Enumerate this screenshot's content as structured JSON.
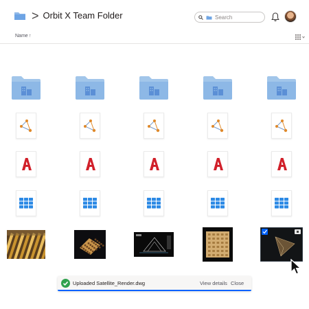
{
  "header": {
    "chevron": ">",
    "title": "Orbit X Team Folder",
    "search_placeholder": "Search",
    "folder_icon": "folder-icon",
    "search_icon": "search-icon",
    "bell_icon": "bell-icon"
  },
  "list": {
    "name_column": "Name",
    "sort_indicator": "↑"
  },
  "rows": [
    {
      "type": "folder",
      "icon": "shared-folder-icon"
    },
    {
      "type": "diagram",
      "icon": "network-diagram-file-icon"
    },
    {
      "type": "autocad",
      "icon": "autocad-file-icon"
    },
    {
      "type": "spreadsheet",
      "icon": "grid-file-icon"
    },
    {
      "type": "images",
      "icon": "image-thumbnail"
    }
  ],
  "toast": {
    "message": "Uploaded Satellite_Render.dwg",
    "view_details": "View details",
    "close": "Close"
  },
  "colors": {
    "folder": "#a2c6ea",
    "folder_dark": "#5b8fd6",
    "accent": "#0061fe",
    "autocad_red": "#d1202a",
    "diagram_orange": "#e0892a",
    "grid_blue": "#2d8ae5",
    "success": "#30a14e"
  }
}
